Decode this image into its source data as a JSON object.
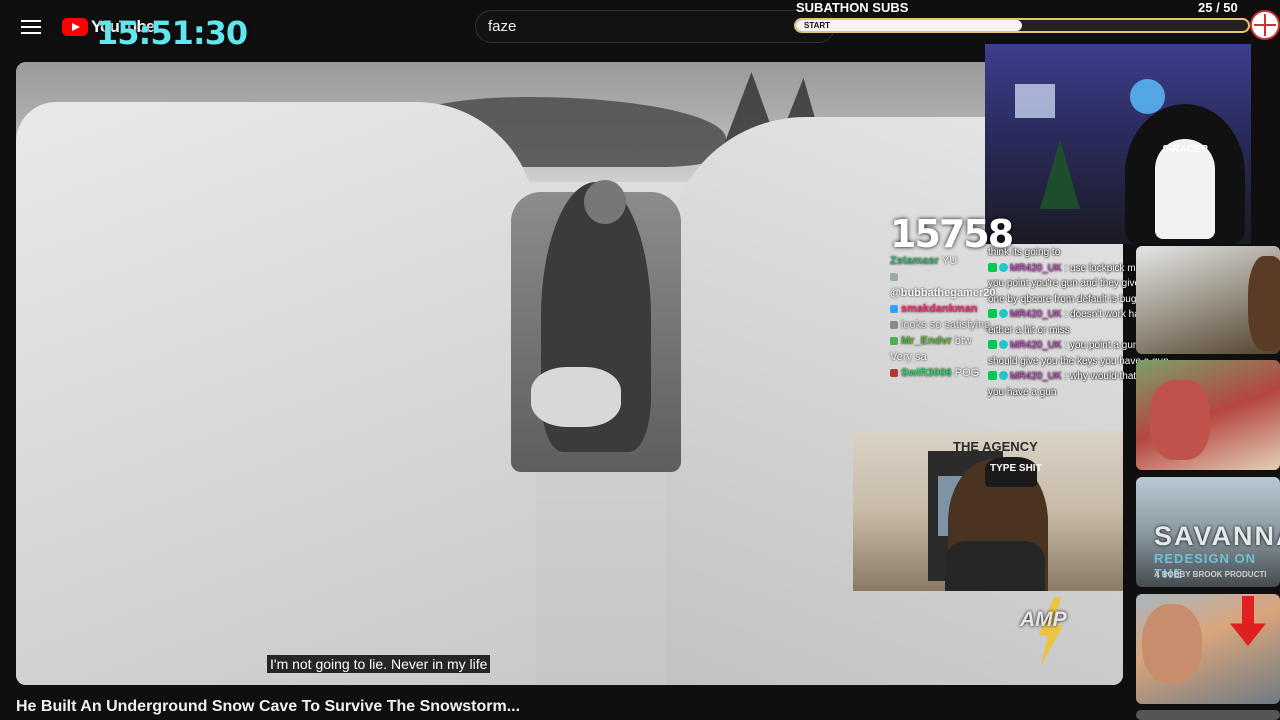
{
  "header": {
    "logo_text": "YouTube",
    "clock": "15:51:30",
    "search_value": "faze"
  },
  "subathon": {
    "title": "SUBATHON SUBS",
    "count": "25  / 50",
    "progress": 0.5,
    "start_label": "START"
  },
  "overlay": {
    "big_number": "15758",
    "amp_label": "AMP"
  },
  "video": {
    "caption": "I'm not going to lie. Never in my life",
    "title": "He Built An Underground Snow Cave To Survive The Snowstorm..."
  },
  "chat_left": [
    {
      "user": "Zstamasr",
      "text": "YU",
      "color": "#3cb371"
    },
    {
      "user": "",
      "text": "",
      "color": "#b0b0b0"
    },
    {
      "user": "@bubbathegamer20",
      "text": "",
      "color": "#ffffff"
    },
    {
      "user": "smakdankman",
      "text": "",
      "color": "#ff2a6d"
    },
    {
      "user": "",
      "text": "looks so satisfying",
      "color": "#b06cff"
    },
    {
      "user": "Mr_Endvr",
      "text": "btw",
      "color": "#59b336"
    },
    {
      "user": "",
      "text": "Very sa",
      "color": "#d2a24a"
    },
    {
      "user": "Swift3006",
      "text": "POG",
      "color": "#33cc66"
    }
  ],
  "chat_right": {
    "lead": "think its going to",
    "messages": [
      {
        "user": "MR420_UK",
        "text": "use lockpick minigame pops up or you point you're gun and they give you the keys the one by qbcore from default is buggy"
      },
      {
        "user": "MR420_UK",
        "text": "doesn't work half of the time its either a hit or miss"
      },
      {
        "user": "MR420_UK",
        "text": "you point a gun at someone they should give you the keys you have a gun"
      },
      {
        "user": "MR420_UK",
        "text": "why would that be a chance thing if you have a gun"
      }
    ]
  },
  "cams": {
    "top_chair_label": "S-RACER",
    "bottom_sign": "THE AGENCY",
    "bottom_hat": "TYPE SHIT"
  },
  "recommended": {
    "t3_title": "SAVANNA",
    "t3_sub": "REDESIGN ON THE",
    "t3_sub2": "A BOBBY BROOK PRODUCTI"
  }
}
